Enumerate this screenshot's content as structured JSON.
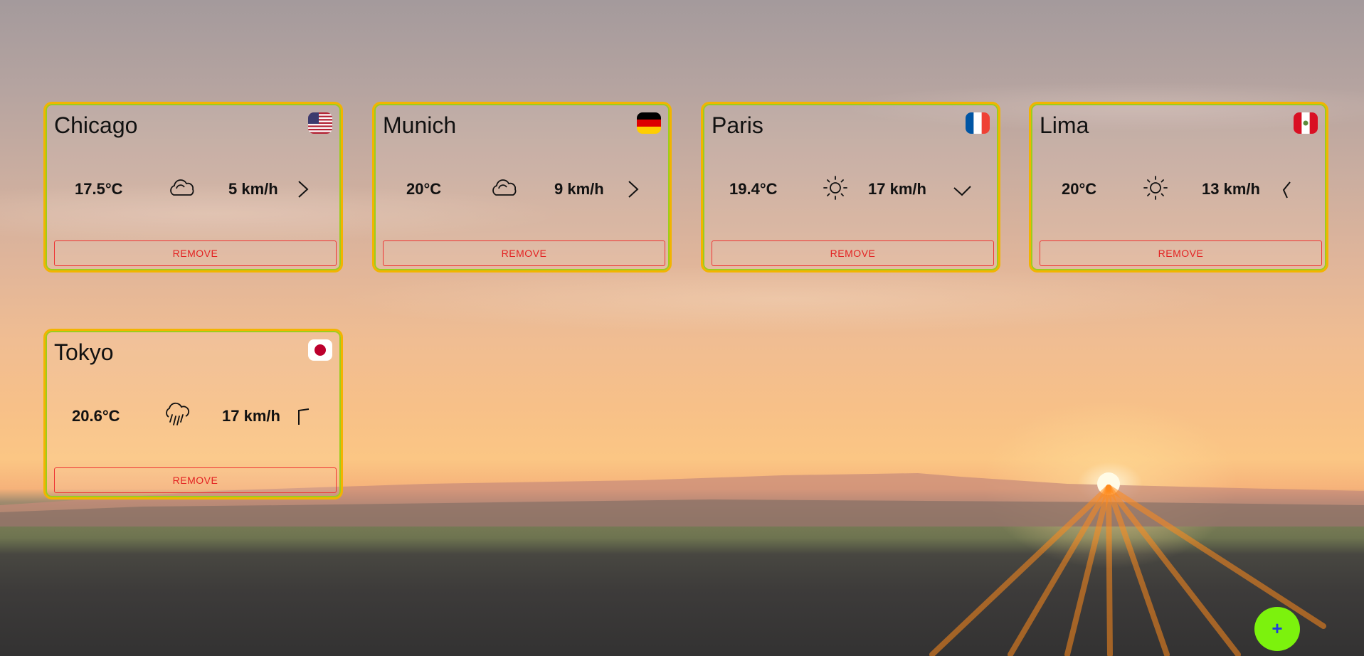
{
  "cities": [
    {
      "name": "Chicago",
      "country_flag": "us-flag",
      "temperature": "17.5°C",
      "weather": "cloudy-icon",
      "wind_speed": "5 km/h",
      "wind_direction": "wind-direction-icon",
      "remove_label": "REMOVE"
    },
    {
      "name": "Munich",
      "country_flag": "de-flag",
      "temperature": "20°C",
      "weather": "cloudy-icon",
      "wind_speed": "9 km/h",
      "wind_direction": "wind-direction-icon",
      "remove_label": "REMOVE"
    },
    {
      "name": "Paris",
      "country_flag": "fr-flag",
      "temperature": "19.4°C",
      "weather": "sun-icon",
      "wind_speed": "17 km/h",
      "wind_direction": "wind-direction-icon",
      "remove_label": "REMOVE"
    },
    {
      "name": "Lima",
      "country_flag": "pe-flag",
      "temperature": "20°C",
      "weather": "sun-icon",
      "wind_speed": "13 km/h",
      "wind_direction": "wind-direction-icon",
      "remove_label": "REMOVE"
    },
    {
      "name": "Tokyo",
      "country_flag": "jp-flag",
      "temperature": "20.6°C",
      "weather": "rain-icon",
      "wind_speed": "17 km/h",
      "wind_direction": "wind-direction-icon",
      "remove_label": "REMOVE"
    }
  ],
  "add_button": {
    "label": "+"
  },
  "colors": {
    "card_border": "#f2b400",
    "card_inner_border": "#9ccd1c",
    "remove": "#e32222",
    "fab_bg": "#7cf20d",
    "fab_text": "#1f3ce0"
  }
}
